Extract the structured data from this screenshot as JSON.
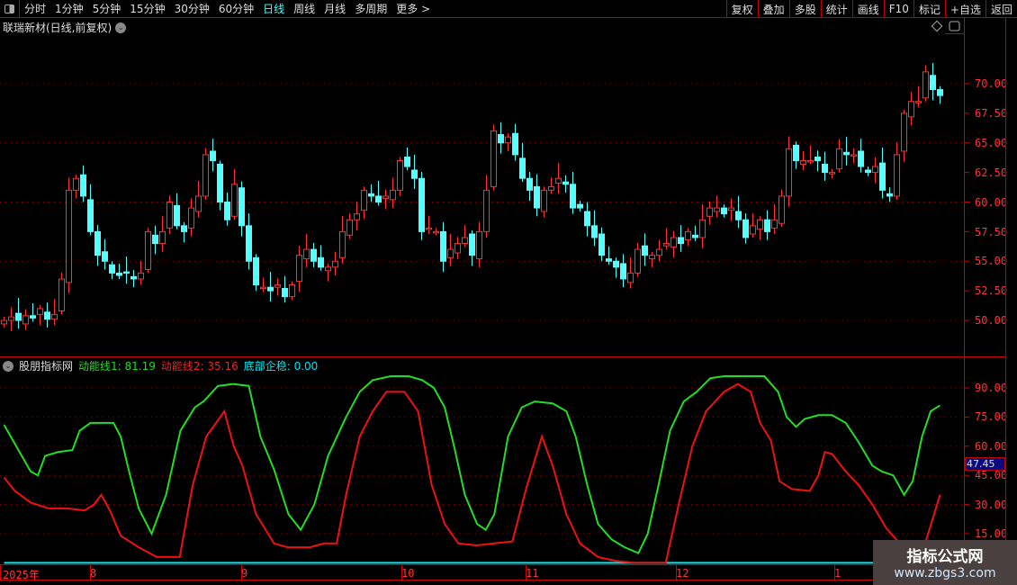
{
  "toolbar": {
    "periods": [
      "分时",
      "1分钟",
      "5分钟",
      "15分钟",
      "30分钟",
      "60分钟",
      "日线",
      "周线",
      "月线",
      "多周期",
      "更多 >"
    ],
    "active": "日线",
    "right_buttons": [
      "复权",
      "叠加",
      "多股",
      "统计",
      "画线",
      "F10",
      "标记",
      "+自选",
      "返回"
    ]
  },
  "main": {
    "title": "联瑞新材(日线,前复权)",
    "price_ticks": [
      "70.00",
      "67.50",
      "65.00",
      "62.50",
      "60.00",
      "57.50",
      "55.00",
      "52.50",
      "50.00"
    ],
    "closes": [
      50,
      50.3,
      50,
      50.4,
      50.2,
      51,
      50.1,
      50.5,
      53.5,
      61,
      62,
      60.5,
      57.5,
      55.5,
      55,
      54,
      53.8,
      54,
      53.5,
      54,
      57.5,
      56.5,
      57.5,
      60,
      58,
      57.5,
      59.5,
      60.5,
      64,
      63.5,
      60,
      58.5,
      61.5,
      58,
      55,
      53,
      52.8,
      52.5,
      53,
      52,
      53,
      55.5,
      56,
      55,
      54.5,
      54.5,
      55,
      57.5,
      58.5,
      59,
      61,
      60.5,
      60,
      60.5,
      61,
      63.5,
      63,
      62,
      57.5,
      57.8,
      57.5,
      55,
      56,
      56.5,
      57,
      55.5,
      57.5,
      61,
      66,
      65,
      65.5,
      64,
      62,
      61,
      59.5,
      61,
      61.3,
      62,
      61.5,
      59.5,
      59.5,
      58,
      57,
      55.5,
      55,
      54.5,
      53.5,
      54,
      56,
      55.5,
      55.5,
      56,
      56.5,
      57,
      56.5,
      57.5,
      57,
      58.5,
      59.5,
      59.5,
      59,
      59.5,
      58.5,
      57,
      58,
      58.5,
      57.5,
      58.5,
      60.5,
      64.5,
      63.5,
      63.5,
      63.5,
      63.5,
      62.5,
      62.5,
      64.5,
      64,
      64,
      63,
      62.5,
      63,
      61,
      60.5,
      64,
      67.5,
      68.5,
      68.5,
      71,
      69.5,
      69
    ]
  },
  "indicator": {
    "name": "股朋指标网",
    "line1_label": "动能线1: 81.19",
    "line2_label": "动能线2: 35.16",
    "line3_label": "底部企稳: 0.00",
    "ticks": [
      "90.00",
      "75.00",
      "60.00",
      "45.00",
      "30.00",
      "15.00"
    ],
    "current_value": "47.45",
    "colors": {
      "line1": "#22dd22",
      "line2": "#ee1111",
      "line3": "#00e5ee"
    },
    "line1": [
      [
        0,
        71
      ],
      [
        2,
        58
      ],
      [
        3.7,
        47
      ],
      [
        4.7,
        45
      ],
      [
        5.7,
        55
      ],
      [
        7.5,
        57
      ],
      [
        9.5,
        58
      ],
      [
        10.5,
        68
      ],
      [
        12,
        72
      ],
      [
        15.2,
        72
      ],
      [
        16.2,
        65
      ],
      [
        17.5,
        45
      ],
      [
        18.7,
        28
      ],
      [
        20.5,
        15
      ],
      [
        22.5,
        35
      ],
      [
        24.5,
        68
      ],
      [
        26.5,
        80
      ],
      [
        27.7,
        83
      ],
      [
        29.7,
        91
      ],
      [
        31.8,
        92
      ],
      [
        34,
        91
      ],
      [
        35.6,
        65
      ],
      [
        37.5,
        48
      ],
      [
        39.5,
        25
      ],
      [
        41.2,
        17
      ],
      [
        43.1,
        30
      ],
      [
        45,
        55
      ],
      [
        47.5,
        75
      ],
      [
        49.4,
        88
      ],
      [
        51.2,
        94
      ],
      [
        53.7,
        96
      ],
      [
        56.2,
        96
      ],
      [
        58.1,
        94
      ],
      [
        59.7,
        90
      ],
      [
        61.2,
        80
      ],
      [
        62.5,
        60
      ],
      [
        64,
        35
      ],
      [
        65.7,
        20
      ],
      [
        66.9,
        17
      ],
      [
        68.1,
        25
      ],
      [
        70,
        65
      ],
      [
        71.9,
        80
      ],
      [
        73.7,
        83
      ],
      [
        76.2,
        82
      ],
      [
        78.1,
        78
      ],
      [
        79.4,
        65
      ],
      [
        81,
        40
      ],
      [
        82.5,
        20
      ],
      [
        84.4,
        12
      ],
      [
        86.2,
        8
      ],
      [
        88.1,
        5
      ],
      [
        89.4,
        15
      ],
      [
        90.9,
        40
      ],
      [
        92.5,
        68
      ],
      [
        94.4,
        83
      ],
      [
        96.2,
        88
      ],
      [
        98.1,
        95
      ],
      [
        100,
        96
      ],
      [
        103.7,
        96
      ],
      [
        105.6,
        96
      ],
      [
        107.5,
        88
      ],
      [
        108.7,
        75
      ],
      [
        110,
        70
      ],
      [
        111.2,
        74
      ],
      [
        113.1,
        76
      ],
      [
        115,
        76
      ],
      [
        116.9,
        72
      ],
      [
        118.7,
        62
      ],
      [
        120.6,
        50
      ],
      [
        121.9,
        47
      ],
      [
        123.5,
        45
      ],
      [
        125,
        35
      ],
      [
        126.2,
        42
      ],
      [
        127.5,
        65
      ],
      [
        128.7,
        78
      ],
      [
        130,
        81
      ]
    ],
    "line2": [
      [
        0,
        44
      ],
      [
        1.5,
        37
      ],
      [
        3.7,
        31
      ],
      [
        6.2,
        28
      ],
      [
        8.7,
        28
      ],
      [
        11.2,
        27
      ],
      [
        12.5,
        30
      ],
      [
        13.5,
        35
      ],
      [
        14.7,
        27
      ],
      [
        16.2,
        14
      ],
      [
        18.7,
        8
      ],
      [
        21.2,
        3
      ],
      [
        24.4,
        3
      ],
      [
        26.2,
        40
      ],
      [
        28.1,
        65
      ],
      [
        30.6,
        78
      ],
      [
        31.9,
        60
      ],
      [
        33.1,
        50
      ],
      [
        35,
        25
      ],
      [
        37.5,
        10
      ],
      [
        39.4,
        8
      ],
      [
        42.5,
        8
      ],
      [
        44.4,
        10
      ],
      [
        46.2,
        10
      ],
      [
        47.5,
        35
      ],
      [
        49.4,
        65
      ],
      [
        51.2,
        78
      ],
      [
        53.1,
        88
      ],
      [
        55.6,
        88
      ],
      [
        57.5,
        78
      ],
      [
        59.4,
        40
      ],
      [
        61.2,
        20
      ],
      [
        63.1,
        10
      ],
      [
        65.6,
        9
      ],
      [
        68.1,
        10
      ],
      [
        70.6,
        11
      ],
      [
        72.5,
        38
      ],
      [
        74.7,
        65
      ],
      [
        76.2,
        50
      ],
      [
        78.1,
        25
      ],
      [
        80,
        10
      ],
      [
        82.5,
        3
      ],
      [
        85,
        1
      ],
      [
        87.5,
        0
      ],
      [
        91.9,
        0
      ],
      [
        93.7,
        30
      ],
      [
        95.6,
        60
      ],
      [
        97.5,
        78
      ],
      [
        100,
        88
      ],
      [
        101.9,
        92
      ],
      [
        103.7,
        88
      ],
      [
        105,
        72
      ],
      [
        106.5,
        63
      ],
      [
        107.7,
        42
      ],
      [
        109.4,
        38
      ],
      [
        111.9,
        37
      ],
      [
        113.1,
        45
      ],
      [
        114,
        57
      ],
      [
        115,
        56
      ],
      [
        116.9,
        47
      ],
      [
        118.7,
        40
      ],
      [
        120.6,
        30
      ],
      [
        122.5,
        18
      ],
      [
        124.4,
        10
      ],
      [
        126.2,
        6
      ],
      [
        128.1,
        12
      ],
      [
        130,
        35
      ]
    ],
    "line3": [
      [
        0,
        0
      ],
      [
        130,
        0
      ]
    ]
  },
  "xaxis": {
    "labels": [
      "2025年",
      "8",
      "9",
      "10",
      "11",
      "12",
      "1"
    ]
  },
  "watermark": {
    "title": "指标公式网",
    "url": "www.zbgs3.com"
  },
  "colors": {
    "up": "#ff3232",
    "down": "#54ffff",
    "grid": "#8b0000",
    "axis": "#cc0000"
  }
}
